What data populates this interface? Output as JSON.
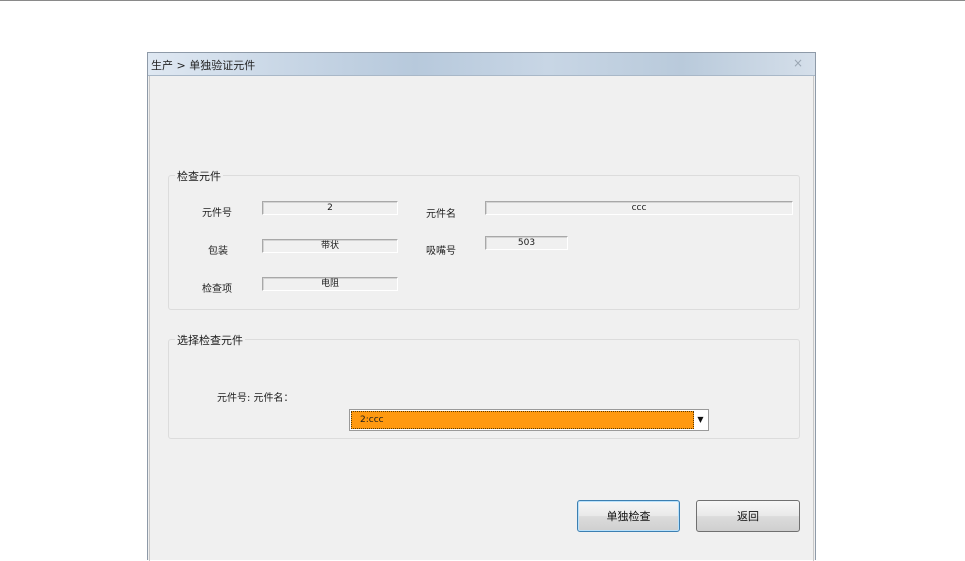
{
  "window": {
    "title": "生产 > 单独验证元件",
    "close_glyph": "×"
  },
  "check_group": {
    "legend": "检查元件",
    "part_no_label": "元件号",
    "part_no_value": "2",
    "part_name_label": "元件名",
    "part_name_value": "ccc",
    "package_label": "包装",
    "package_value": "带状",
    "nozzle_label": "吸嘴号",
    "nozzle_value": "503",
    "check_item_label": "检查项",
    "check_item_value": "电阻"
  },
  "select_group": {
    "legend": "选择检查元件",
    "combo_label": "元件号: 元件名：",
    "combo_value": "2:ccc",
    "combo_arrow_icon": "chevron-down-icon",
    "combo_arrow_glyph": "▼",
    "highlight_color": "#ff9910"
  },
  "buttons": {
    "single_check": "单独检查",
    "back": "返回"
  }
}
